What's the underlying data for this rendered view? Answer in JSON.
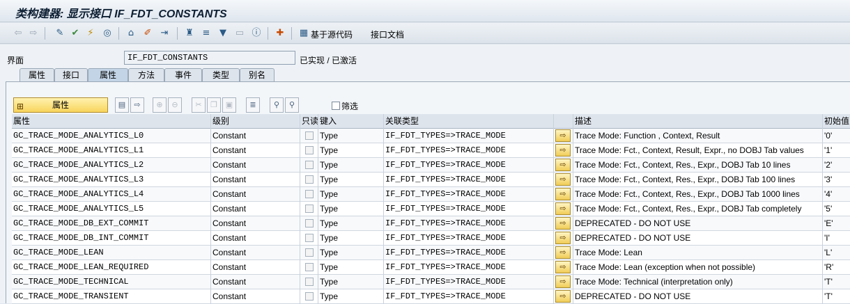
{
  "window": {
    "title": "类构建器: 显示接口 IF_FDT_CONSTANTS"
  },
  "toolbar": {
    "source_code_label": "基于源代码",
    "doc_label": "接口文档"
  },
  "interface": {
    "label": "界面",
    "value": "IF_FDT_CONSTANTS",
    "status": "已实现 / 已激活"
  },
  "tabs": [
    {
      "label": "属性"
    },
    {
      "label": "接口"
    },
    {
      "label": "属性"
    },
    {
      "label": "方法"
    },
    {
      "label": "事件"
    },
    {
      "label": "类型"
    },
    {
      "label": "别名"
    }
  ],
  "active_tab": "属性",
  "attr_button": {
    "label": "属性"
  },
  "filter": {
    "label": "筛选",
    "checked": false
  },
  "columns": [
    "属性",
    "级别",
    "只读",
    "键入",
    "关联类型",
    "",
    "描述",
    "初始值"
  ],
  "rows": [
    {
      "name": "GC_TRACE_MODE_ANALYTICS_L0",
      "level": "Constant",
      "typing": "Type",
      "assoc": "IF_FDT_TYPES=>TRACE_MODE",
      "desc": "Trace Mode: Function , Context, Result",
      "init": "'0'"
    },
    {
      "name": "GC_TRACE_MODE_ANALYTICS_L1",
      "level": "Constant",
      "typing": "Type",
      "assoc": "IF_FDT_TYPES=>TRACE_MODE",
      "desc": "Trace Mode: Fct., Context, Result, Expr., no DOBJ Tab values",
      "init": "'1'"
    },
    {
      "name": "GC_TRACE_MODE_ANALYTICS_L2",
      "level": "Constant",
      "typing": "Type",
      "assoc": "IF_FDT_TYPES=>TRACE_MODE",
      "desc": "Trace Mode: Fct., Context, Res., Expr., DOBJ Tab 10 lines",
      "init": "'2'"
    },
    {
      "name": "GC_TRACE_MODE_ANALYTICS_L3",
      "level": "Constant",
      "typing": "Type",
      "assoc": "IF_FDT_TYPES=>TRACE_MODE",
      "desc": "Trace Mode: Fct., Context, Res., Expr., DOBJ Tab 100 lines",
      "init": "'3'"
    },
    {
      "name": "GC_TRACE_MODE_ANALYTICS_L4",
      "level": "Constant",
      "typing": "Type",
      "assoc": "IF_FDT_TYPES=>TRACE_MODE",
      "desc": "Trace Mode: Fct., Context, Res., Expr., DOBJ Tab 1000 lines",
      "init": "'4'"
    },
    {
      "name": "GC_TRACE_MODE_ANALYTICS_L5",
      "level": "Constant",
      "typing": "Type",
      "assoc": "IF_FDT_TYPES=>TRACE_MODE",
      "desc": "Trace Mode: Fct., Context, Res., Expr., DOBJ Tab completely",
      "init": "'5'"
    },
    {
      "name": "GC_TRACE_MODE_DB_EXT_COMMIT",
      "level": "Constant",
      "typing": "Type",
      "assoc": "IF_FDT_TYPES=>TRACE_MODE",
      "desc": "DEPRECATED - DO NOT USE",
      "init": "'E'"
    },
    {
      "name": "GC_TRACE_MODE_DB_INT_COMMIT",
      "level": "Constant",
      "typing": "Type",
      "assoc": "IF_FDT_TYPES=>TRACE_MODE",
      "desc": "DEPRECATED - DO NOT USE",
      "init": "'I'"
    },
    {
      "name": "GC_TRACE_MODE_LEAN",
      "level": "Constant",
      "typing": "Type",
      "assoc": "IF_FDT_TYPES=>TRACE_MODE",
      "desc": "Trace Mode: Lean",
      "init": "'L'"
    },
    {
      "name": "GC_TRACE_MODE_LEAN_REQUIRED",
      "level": "Constant",
      "typing": "Type",
      "assoc": "IF_FDT_TYPES=>TRACE_MODE",
      "desc": "Trace Mode: Lean (exception when not possible)",
      "init": "'R'"
    },
    {
      "name": "GC_TRACE_MODE_TECHNICAL",
      "level": "Constant",
      "typing": "Type",
      "assoc": "IF_FDT_TYPES=>TRACE_MODE",
      "desc": "Trace Mode: Technical (interpretation only)",
      "init": "'T'"
    },
    {
      "name": "GC_TRACE_MODE_TRANSIENT",
      "level": "Constant",
      "typing": "Type",
      "assoc": "IF_FDT_TYPES=>TRACE_MODE",
      "desc": "DEPRECATED - DO NOT USE",
      "init": "'T'"
    }
  ]
}
